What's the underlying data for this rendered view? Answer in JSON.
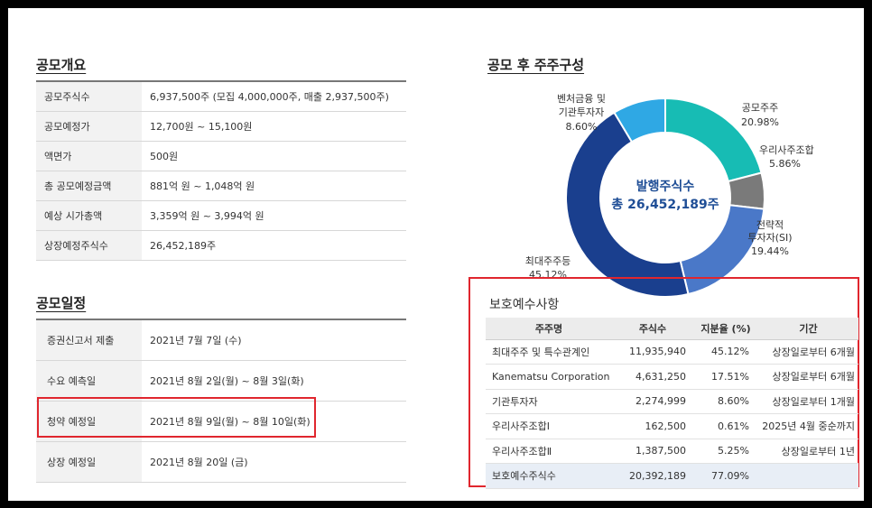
{
  "offering": {
    "title": "공모개요",
    "rows": [
      {
        "label": "공모주식수",
        "value": "6,937,500주 (모집 4,000,000주, 매출 2,937,500주)"
      },
      {
        "label": "공모예정가",
        "value": "12,700원 ~ 15,100원"
      },
      {
        "label": "액면가",
        "value": "500원"
      },
      {
        "label": "총 공모예정금액",
        "value": "881억 원 ~ 1,048억 원"
      },
      {
        "label": "예상 시가총액",
        "value": "3,359억 원 ~ 3,994억 원"
      },
      {
        "label": "상장예정주식수",
        "value": "26,452,189주"
      }
    ]
  },
  "schedule": {
    "title": "공모일정",
    "rows": [
      {
        "label": "증권신고서 제출",
        "value": "2021년 7월 7일 (수)"
      },
      {
        "label": "수요 예측일",
        "value": "2021년 8월 2일(월) ~ 8월 3일(화)"
      },
      {
        "label": "청약 예정일",
        "value": "2021년 8월 9일(월) ~ 8월 10일(화)"
      },
      {
        "label": "상장 예정일",
        "value": "2021년 8월 20일 (금)"
      }
    ]
  },
  "shareholders": {
    "title": "공모 후 주주구성",
    "center_line1": "발행주식수",
    "center_line2": "총 26,452,189주",
    "label_1a": "벤처금융 및",
    "label_1b": "기관투자자",
    "label_1c": "8.60%",
    "label_2a": "공모주주",
    "label_2b": "20.98%",
    "label_3a": "우리사주조합",
    "label_3b": "5.86%",
    "label_4a": "전략적",
    "label_4b": "투자자(SI)",
    "label_4c": "19.44%",
    "label_5a": "최대주주등",
    "label_5b": "45.12%"
  },
  "chart_data": {
    "type": "pie",
    "categories": [
      "공모주주",
      "우리사주조합",
      "전략적 투자자(SI)",
      "최대주주등",
      "벤처금융 및 기관투자자"
    ],
    "values": [
      20.98,
      5.86,
      19.44,
      45.12,
      8.6
    ],
    "colors": [
      "#17bcb4",
      "#7a7a7a",
      "#4a78c8",
      "#1a3f8e",
      "#2fa8e4"
    ],
    "title": "공모 후 주주구성"
  },
  "lockup": {
    "title": "보호예수사항",
    "headers": [
      "주주명",
      "주식수",
      "지분율 (%)",
      "기간"
    ],
    "rows": [
      [
        "최대주주 및 특수관계인",
        "11,935,940",
        "45.12%",
        "상장일로부터 6개월"
      ],
      [
        "Kanematsu Corporation",
        "4,631,250",
        "17.51%",
        "상장일로부터 6개월"
      ],
      [
        "기관투자자",
        "2,274,999",
        "8.60%",
        "상장일로부터 1개월"
      ],
      [
        "우리사주조합Ⅰ",
        "162,500",
        "0.61%",
        "2025년 4월 중순까지"
      ],
      [
        "우리사주조합Ⅱ",
        "1,387,500",
        "5.25%",
        "상장일로부터 1년"
      ],
      [
        "보호예수주식수",
        "20,392,189",
        "77.09%",
        ""
      ]
    ]
  }
}
